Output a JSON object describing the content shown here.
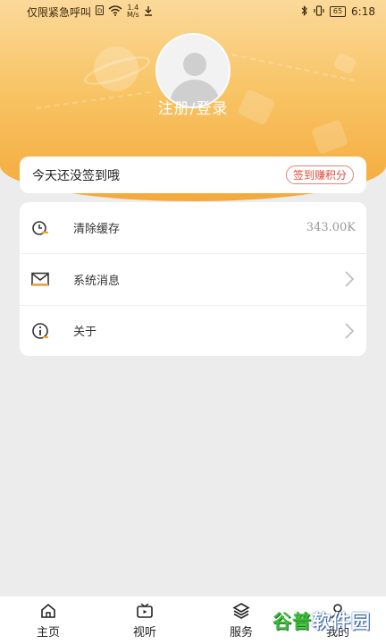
{
  "status_bar": {
    "carrier": "仅限紧急呼叫",
    "net_speed_value": "1.4",
    "net_speed_unit": "M/s",
    "battery": "65",
    "time": "6:18"
  },
  "profile": {
    "login_label": "注册/登录"
  },
  "sign_in": {
    "prompt": "今天还没签到哦",
    "button_label": "签到赚积分"
  },
  "menu": {
    "items": [
      {
        "label": "清除缓存",
        "value": "343.00K",
        "icon": "clear-cache-icon"
      },
      {
        "label": "系统消息",
        "icon": "mail-icon"
      },
      {
        "label": "关于",
        "icon": "info-icon"
      }
    ]
  },
  "tabbar": {
    "tabs": [
      {
        "label": "主页",
        "icon": "home-icon"
      },
      {
        "label": "视听",
        "icon": "video-icon"
      },
      {
        "label": "服务",
        "icon": "layers-icon"
      },
      {
        "label": "我的",
        "icon": "user-icon"
      }
    ]
  },
  "watermark": {
    "brand_a": "谷普",
    "brand_b": "软件园"
  },
  "colors": {
    "header_top": "#fbd99a",
    "header_bottom": "#f4a93a",
    "accent_red": "#e24a3b",
    "page_bg": "#ececec"
  }
}
